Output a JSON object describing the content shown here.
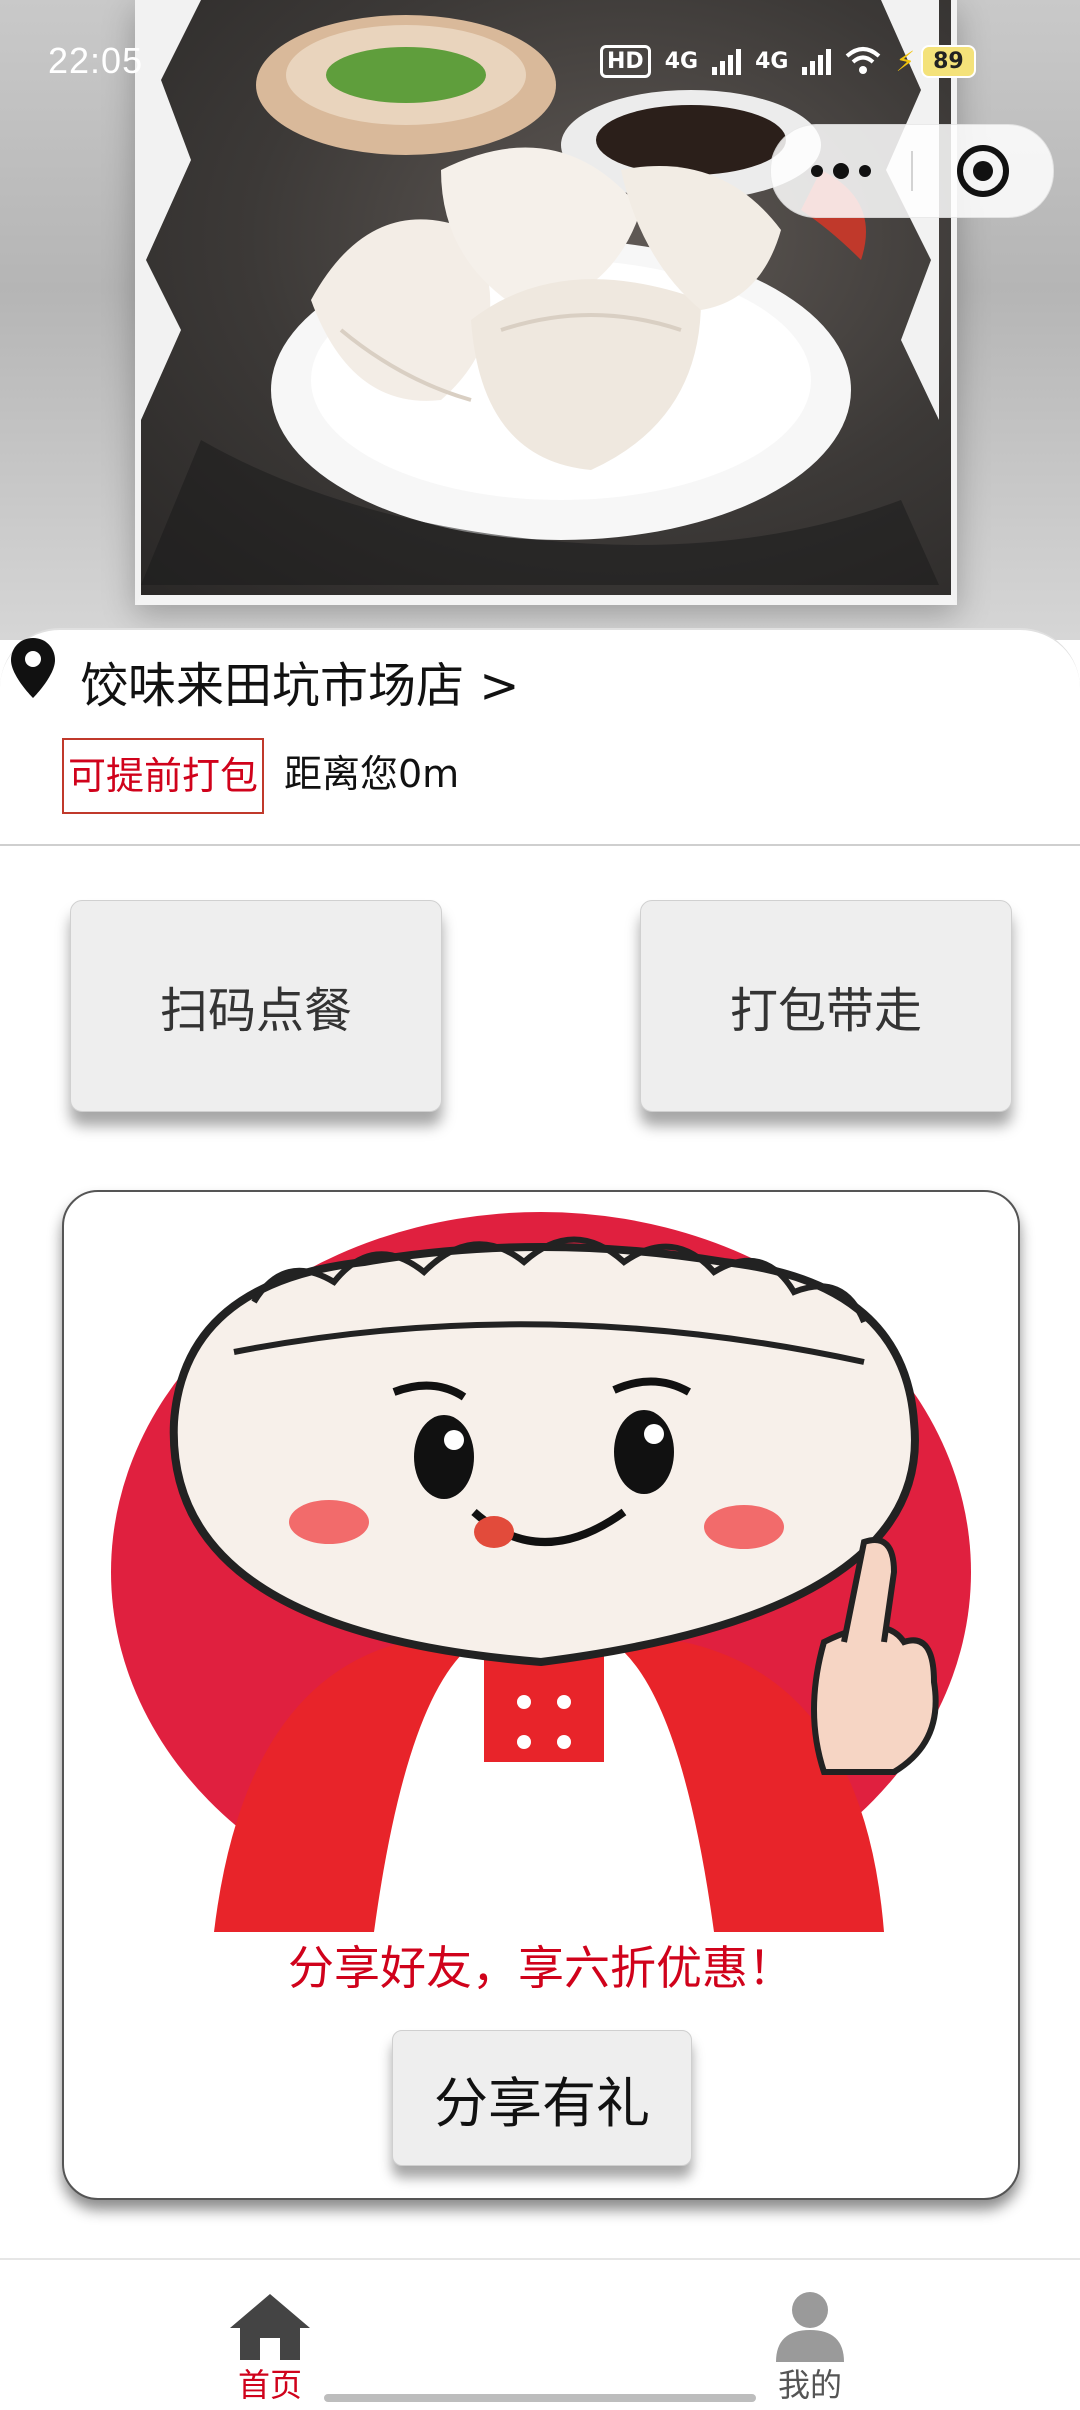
{
  "status_bar": {
    "time": "22:05",
    "hd_label": "HD",
    "network_1": "4G",
    "network_2": "4G",
    "battery": "89"
  },
  "capsule": {
    "more_icon": "more-dots-icon",
    "close_icon": "target-close-icon"
  },
  "store": {
    "name": "饺味来田坑市场店 >",
    "tag": "可提前打包",
    "distance": "距离您0m"
  },
  "actions": {
    "scan_label": "扫码点餐",
    "takeaway_label": "打包带走"
  },
  "promo": {
    "text": "分享好友，享六折优惠！",
    "button_label": "分享有礼"
  },
  "tabbar": {
    "items": [
      {
        "label": "首页",
        "icon": "home-icon",
        "active": true
      },
      {
        "label": "我的",
        "icon": "user-icon",
        "active": false
      }
    ]
  },
  "colors": {
    "accent_red": "#d0021b",
    "button_bg": "#eeeeee"
  }
}
